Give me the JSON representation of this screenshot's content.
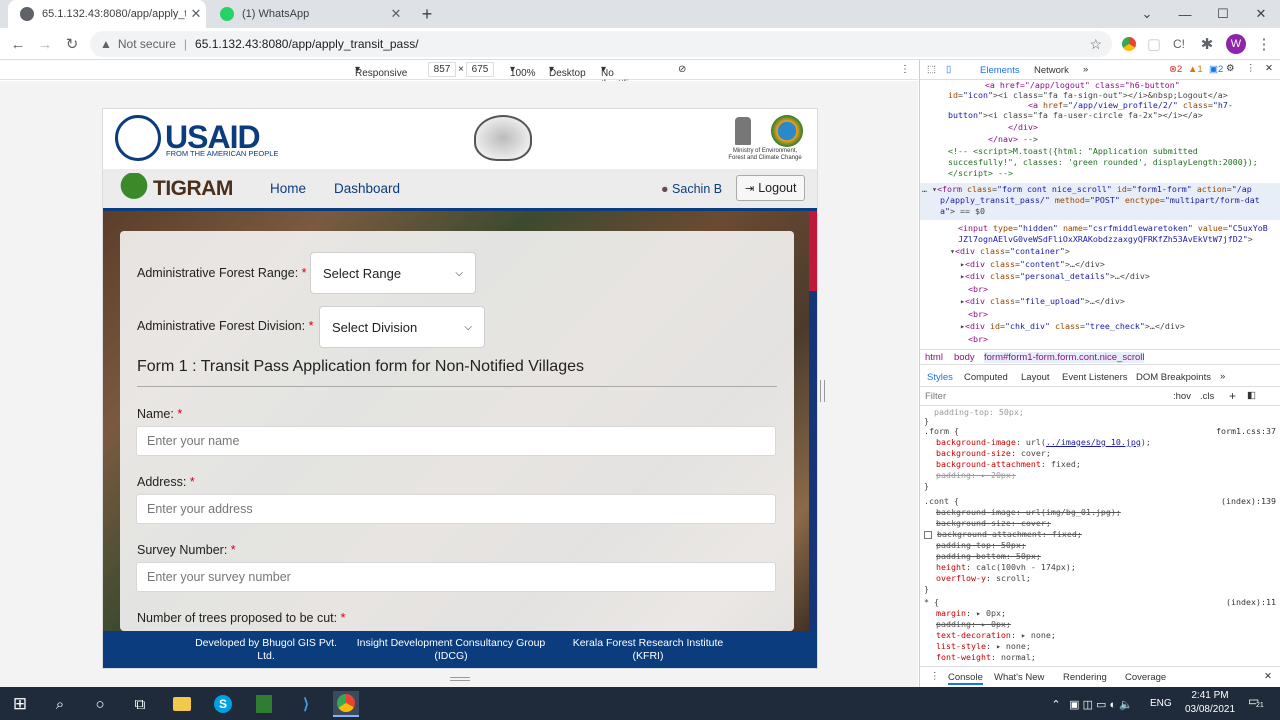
{
  "browser": {
    "tabs": [
      {
        "title": "65.1.132.43:8080/app/apply_tran",
        "active": true
      },
      {
        "title": "(1) WhatsApp",
        "active": false
      }
    ],
    "url_security": "Not secure",
    "url": "65.1.132.43:8080/app/apply_transit_pass/",
    "profile_initial": "W"
  },
  "device_toolbar": {
    "mode": "Responsive",
    "width": "857",
    "height": "675",
    "zoom": "100%",
    "device": "Desktop",
    "throttling": "No throttling"
  },
  "site": {
    "usaid_name": "USAID",
    "usaid_tagline": "FROM THE AMERICAN PEOPLE",
    "ministry_line1": "Ministry of Environment,",
    "ministry_line2": "Forest and Climate Change",
    "brand": "TIGRAM",
    "nav": {
      "home": "Home",
      "dashboard": "Dashboard",
      "user": "Sachin B",
      "logout": "Logout"
    }
  },
  "form": {
    "range_label": "Administrative Forest Range:",
    "range_select": "Select Range",
    "division_label": "Administrative Forest Division:",
    "division_select": "Select Division",
    "heading": "Form 1 : Transit Pass Application form for Non-Notified Villages",
    "req": "*",
    "name_label": "Name:",
    "name_placeholder": "Enter your name",
    "address_label": "Address:",
    "address_placeholder": "Enter your address",
    "survey_label": "Survey Number:",
    "survey_placeholder": "Enter your survey number",
    "trees_label": "Number of trees proposed to be cut:"
  },
  "footer": {
    "col1": "Developed by Bhugol GIS Pvt. Ltd.",
    "col2": "Insight Development Consultancy Group (IDCG)",
    "col3": "Kerala Forest Research Institute (KFRI)"
  },
  "devtools": {
    "tabs": [
      "Elements",
      "Network"
    ],
    "errors": "2",
    "warnings": "1",
    "messages": "2",
    "breadcrumb": [
      "html",
      "body",
      "form#form1-form.form.cont.nice_scroll"
    ],
    "style_tabs": [
      "Styles",
      "Computed",
      "Layout",
      "Event Listeners",
      "DOM Breakpoints"
    ],
    "filter_placeholder": "Filter",
    "hov": ":hov",
    "cls": ".cls",
    "bottom_tabs": [
      "Console",
      "What's New",
      "Rendering",
      "Coverage"
    ]
  },
  "taskbar": {
    "lang": "ENG",
    "time": "2:41 PM",
    "date": "03/08/2021",
    "notifications": "21"
  }
}
